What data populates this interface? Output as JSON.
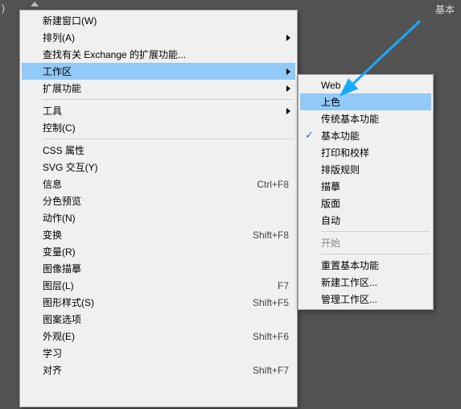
{
  "topbar": {
    "left_fragment": ")",
    "right_label": "基本"
  },
  "menu": {
    "new_window": "新建窗口(W)",
    "arrange": "排列(A)",
    "find_exchange": "查找有关 Exchange 的扩展功能...",
    "workspace": "工作区",
    "extensions": "扩展功能",
    "tools": "工具",
    "control": "控制(C)",
    "css_props": "CSS 属性",
    "svg_interact": "SVG 交互(Y)",
    "info": "信息",
    "info_shortcut": "Ctrl+F8",
    "sep_preview": "分色预览",
    "actions": "动作(N)",
    "transform": "变换",
    "transform_shortcut": "Shift+F8",
    "variables": "变量(R)",
    "image_trace": "图像描摹",
    "layers": "图层(L)",
    "layers_shortcut": "F7",
    "graphic_styles": "图形样式(S)",
    "graphic_styles_shortcut": "Shift+F5",
    "pattern_options": "图案选项",
    "appearance": "外观(E)",
    "appearance_shortcut": "Shift+F6",
    "learn": "学习",
    "align": "对齐",
    "align_shortcut": "Shift+F7"
  },
  "submenu": {
    "web": "Web",
    "painting": "上色",
    "legacy_essentials": "传统基本功能",
    "essentials": "基本功能",
    "print_proof": "打印和校样",
    "typography": "排版规则",
    "tracing": "描摹",
    "layout": "版面",
    "auto": "自动",
    "start": "开始",
    "reset": "重置基本功能",
    "new_ws": "新建工作区...",
    "manage_ws": "管理工作区..."
  }
}
